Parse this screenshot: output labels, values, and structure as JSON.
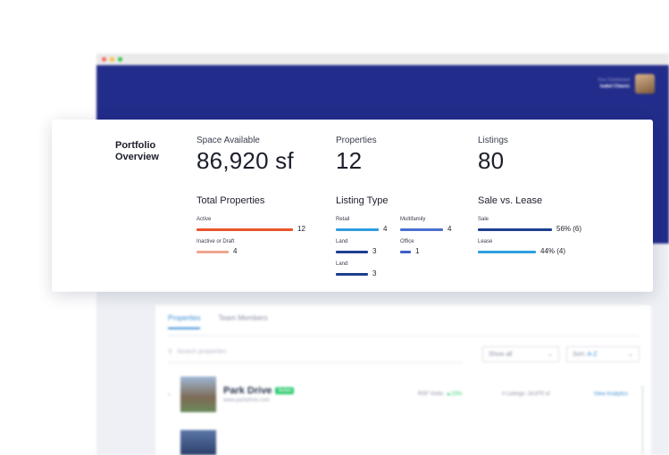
{
  "background_app": {
    "header": {
      "user_subtitle": "Your Dashboard",
      "user_name": "Isabel Chavez",
      "avatar_icon": "user-avatar"
    },
    "tabs": [
      {
        "label": "Properties",
        "active": true
      },
      {
        "label": "Team Members",
        "active": false
      }
    ],
    "search_placeholder": "Search properties",
    "view_select": {
      "value": "Show all"
    },
    "sort_select": {
      "label": "Sort:",
      "value": "A-Z"
    },
    "rows": [
      {
        "name": "Park Drive",
        "status": "Active",
        "url": "www.parkdrive.com",
        "visits_label": "RSF Visits:",
        "visits_value": "▲23%",
        "listings_label": "# Listings:",
        "listings_value": "24,870 sf",
        "link": "View Analytics"
      }
    ]
  },
  "card": {
    "title": "Portfolio Overview",
    "kpis": [
      {
        "label": "Space Available",
        "value": "86,920 sf"
      },
      {
        "label": "Properties",
        "value": "12"
      },
      {
        "label": "Listings",
        "value": "80"
      }
    ],
    "total_properties": {
      "title": "Total Properties",
      "items": [
        {
          "label": "Active",
          "value": "12",
          "fraction": 1.0,
          "color": "#e8562a"
        },
        {
          "label": "Inactive or Draft",
          "value": "4",
          "fraction": 0.33,
          "color": "#f1a48e"
        }
      ]
    },
    "listing_type": {
      "title": "Listing Type",
      "items": [
        {
          "label": "Retail",
          "value": "4",
          "fraction": 1.0,
          "color": "#2f9ee0"
        },
        {
          "label": "Multifamily",
          "value": "4",
          "fraction": 1.0,
          "color": "#4a6fd1"
        },
        {
          "label": "Land",
          "value": "3",
          "fraction": 0.75,
          "color": "#1c3f8f"
        },
        {
          "label": "Office",
          "value": "1",
          "fraction": 0.25,
          "color": "#3e5ec9"
        },
        {
          "label": "Land",
          "value": "3",
          "fraction": 0.75,
          "color": "#1c3f8f"
        }
      ]
    },
    "sale_vs_lease": {
      "title": "Sale vs. Lease",
      "items": [
        {
          "label": "Sale",
          "value": "56% (6)",
          "fraction": 0.56,
          "color": "#1c3f8f"
        },
        {
          "label": "Lease",
          "value": "44% (4)",
          "fraction": 0.44,
          "color": "#2f9ee0"
        }
      ]
    }
  }
}
